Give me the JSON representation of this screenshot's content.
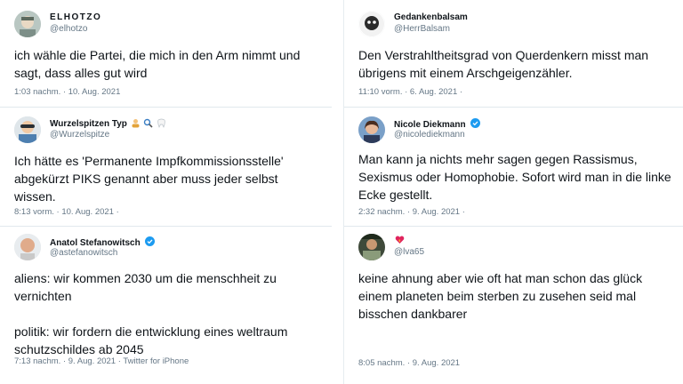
{
  "left": [
    {
      "name": "ELHOTZO",
      "handle": "@elhotzo",
      "text": "ich wähle die Partei, die mich in den Arm nimmt und sagt, dass alles gut wird",
      "meta": "1:03 nachm. · 10. Aug. 2021"
    },
    {
      "name": "Wurzelspitzen Typ",
      "name_emojis": [
        "person-icon",
        "magnifier-icon",
        "tooth-icon"
      ],
      "handle": "@Wurzelspitze",
      "text": "Ich hätte es 'Permanente Impfkommissionsstelle' abgekürzt PIKS genannt aber muss jeder selbst wissen.",
      "meta": "8:13 vorm. · 10. Aug. 2021 ·"
    },
    {
      "name": "Anatol Stefanowitsch",
      "verified": true,
      "handle": "@astefanowitsch",
      "text": "aliens: wir kommen 2030 um die menschheit zu vernichten\n\npolitik: wir fordern die entwicklung eines weltraum schutzschildes ab 2045",
      "meta": "7:13 nachm. · 9. Aug. 2021 · Twitter for iPhone"
    }
  ],
  "right": [
    {
      "name": "Gedankenbalsam",
      "handle": "@HerrBalsam",
      "text": "Den Verstrahltheitsgrad von Querdenkern misst man übrigens mit einem Arschgeigenzähler.",
      "meta": "11:10 vorm. · 6. Aug. 2021 ·"
    },
    {
      "name": "Nicole Diekmann",
      "verified": true,
      "handle": "@nicolediekmann",
      "text": "Man kann ja nichts mehr sagen gegen Rassismus, Sexismus oder Homophobie. Sofort wird man in die linke Ecke gestellt.",
      "meta": "2:32 nachm. · 9. Aug. 2021 ·"
    },
    {
      "name": "",
      "name_emojis": [
        "heart-fire-icon"
      ],
      "handle": "@lva65",
      "text": "keine ahnung aber wie oft hat man schon das glück einem planeten beim sterben zu zusehen seid mal bisschen dankbarer",
      "meta": "8:05 nachm. · 9. Aug. 2021"
    }
  ],
  "colors": {
    "verified": "#1d9bf0",
    "meta": "#657786",
    "divider": "#e1e8ed"
  }
}
